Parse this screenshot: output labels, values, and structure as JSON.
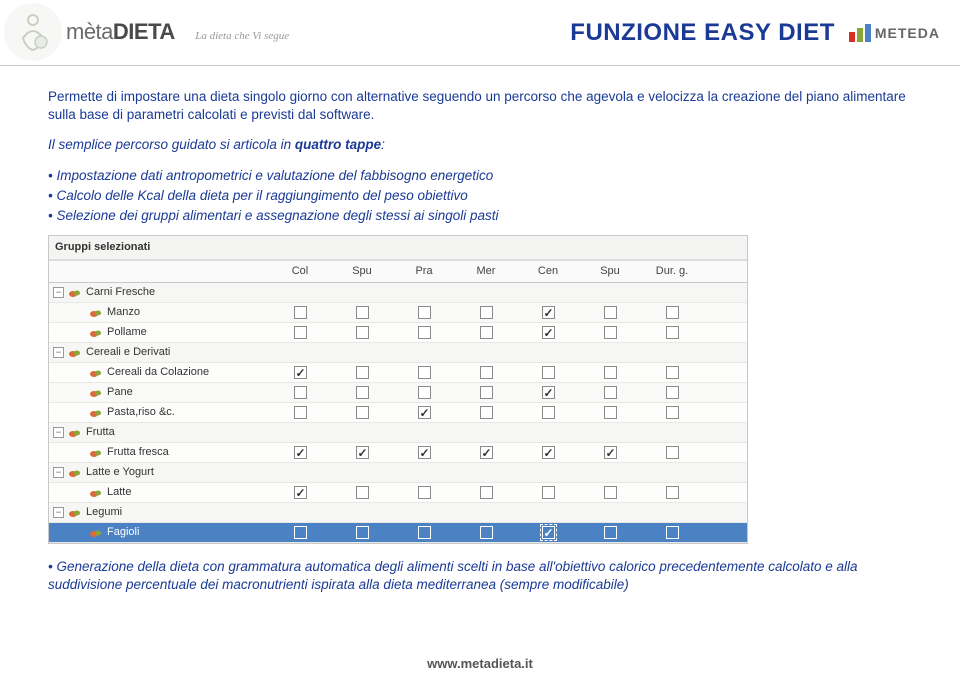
{
  "header": {
    "brand_prefix": "mèta",
    "brand_suffix": "DIETA",
    "tagline": "La dieta che Vi segue",
    "title": "FUNZIONE EASY DIET",
    "meteda_label": "METEDA"
  },
  "intro": "Permette di impostare una dieta singolo giorno con alternative seguendo un percorso che agevola e velocizza la creazione del piano alimentare sulla base di parametri calcolati e previsti dal software.",
  "percorso_lead_a": "Il semplice percorso guidato si articola in ",
  "percorso_bold": "quattro tappe",
  "percorso_lead_b": ":",
  "bullets_top": [
    "Impostazione dati antropometrici e valutazione del fabbisogno energetico",
    "Calcolo delle Kcal della dieta per il raggiungimento del peso obiettivo",
    "Selezione dei gruppi alimentari e assegnazione degli stessi ai singoli pasti"
  ],
  "panel": {
    "title": "Gruppi selezionati",
    "columns": [
      "",
      "Col",
      "Spu",
      "Pra",
      "Mer",
      "Cen",
      "Spu",
      "Dur. g."
    ],
    "rows": [
      {
        "type": "group",
        "label": "Carni Fresche",
        "checks": [
          null,
          null,
          null,
          null,
          null,
          null,
          null
        ]
      },
      {
        "type": "item",
        "label": "Manzo",
        "checks": [
          false,
          false,
          false,
          false,
          true,
          false,
          false
        ]
      },
      {
        "type": "item",
        "label": "Pollame",
        "checks": [
          false,
          false,
          false,
          false,
          true,
          false,
          false
        ]
      },
      {
        "type": "group",
        "label": "Cereali e Derivati",
        "checks": [
          null,
          null,
          null,
          null,
          null,
          null,
          null
        ]
      },
      {
        "type": "item",
        "label": "Cereali da Colazione",
        "checks": [
          true,
          false,
          false,
          false,
          false,
          false,
          false
        ]
      },
      {
        "type": "item",
        "label": "Pane",
        "checks": [
          false,
          false,
          false,
          false,
          true,
          false,
          false
        ]
      },
      {
        "type": "item",
        "label": "Pasta,riso &c.",
        "checks": [
          false,
          false,
          true,
          false,
          false,
          false,
          false
        ]
      },
      {
        "type": "group",
        "label": "Frutta",
        "checks": [
          null,
          null,
          null,
          null,
          null,
          null,
          null
        ]
      },
      {
        "type": "item",
        "label": "Frutta fresca",
        "checks": [
          true,
          true,
          true,
          true,
          true,
          true,
          false
        ]
      },
      {
        "type": "group",
        "label": "Latte e Yogurt",
        "checks": [
          null,
          null,
          null,
          null,
          null,
          null,
          null
        ]
      },
      {
        "type": "item",
        "label": "Latte",
        "checks": [
          true,
          false,
          false,
          false,
          false,
          false,
          false
        ]
      },
      {
        "type": "group",
        "label": "Legumi",
        "checks": [
          null,
          null,
          null,
          null,
          null,
          null,
          null
        ]
      },
      {
        "type": "item",
        "label": "Fagioli",
        "selected": true,
        "checks": [
          false,
          false,
          false,
          false,
          true,
          false,
          false
        ],
        "pending": 4
      }
    ]
  },
  "bullet_bottom": "Generazione della dieta  con grammatura automatica degli alimenti scelti in base all'obiettivo calorico precedentemente calcolato e alla suddivisione percentuale dei macronutrienti ispirata alla dieta mediterranea (sempre modificabile)",
  "footer": "www.metadieta.it"
}
